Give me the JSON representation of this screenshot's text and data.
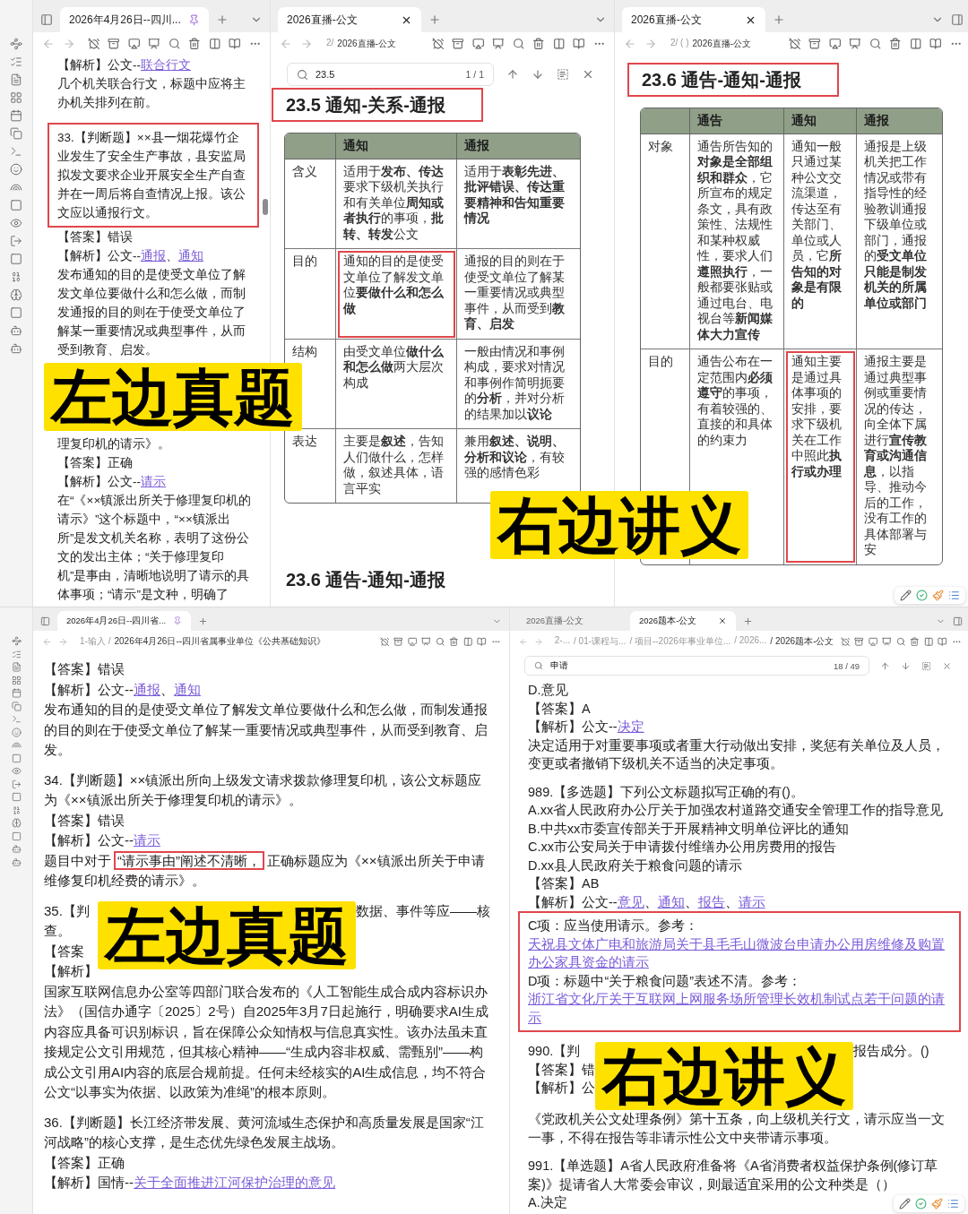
{
  "rows": [
    {
      "panes": [
        {
          "tabs": [
            {
              "label": "2026年4月26日--四川...",
              "selected": true,
              "pinned": true
            }
          ],
          "sections": [
            [
              {
                "kind": "text",
                "segments": [
                  {
                    "text": "【解析】公文--",
                    "link": false
                  },
                  {
                    "text": "联合行文",
                    "link": true
                  }
                ]
              },
              {
                "kind": "text",
                "text": "几个机关联合行文，标题中应将主办机关排列在前。"
              }
            ],
            [
              {
                "kind": "boxed",
                "paragraphs": [
                  {
                    "text": "33.【判断题】××县一烟花爆竹企业发生了安全生产事故，县安监局拟发文要求企业开展安全生产自查并在一周后将自查情况上报。该公文应以通报行文。"
                  }
                ]
              },
              {
                "kind": "text",
                "text": "【答案】错误"
              },
              {
                "kind": "text",
                "segments": [
                  {
                    "text": "【解析】公文--",
                    "link": false
                  },
                  {
                    "text": "通报",
                    "link": true
                  },
                  {
                    "text": "、",
                    "link": false
                  },
                  {
                    "text": "通知",
                    "link": true
                  }
                ]
              },
              {
                "kind": "text",
                "text": "发布通知的目的是使受文单位了解发文单位要做什么和怎么做，而制发通报的目的则在于使受文单位了解某一重要情况或典型事件，从而受到教育、启发。"
              },
              {
                "kind": "banner",
                "text": "左边真题"
              },
              {
                "kind": "text",
                "text": "理复印机的请示》。"
              },
              {
                "kind": "text",
                "text": "【答案】正确"
              },
              {
                "kind": "text",
                "segments": [
                  {
                    "text": "【解析】公文--",
                    "link": false
                  },
                  {
                    "text": "请示",
                    "link": true
                  }
                ]
              },
              {
                "kind": "text",
                "text": "在“《××镇派出所关于修理复印机的请示》”这个标题中，“××镇派出所”是发文机关名称，表明了这份公文的发出主体；“关于修理复印机”是事由，清晰地说明了请示的具体事项；“请示”是文种，明确了"
              }
            ]
          ]
        },
        {
          "tabs": [
            {
              "label": "2026直播-公文",
              "selected": true,
              "pinned": false
            }
          ],
          "breadcrumb": [
            "2/",
            "2026直播-公文"
          ],
          "search": {
            "query": "23.5",
            "count": "1 / 1"
          },
          "sections": [
            [
              {
                "kind": "heading",
                "text": "23.5 通知-关系-通报",
                "highlighted": true
              }
            ],
            [
              {
                "kind": "table",
                "columns": [
                  "通知",
                  "通报"
                ],
                "rows": [
                  {
                    "label": "含义",
                    "cells": [
                      {
                        "text": "适用于**发布、传达**要求下级机关执行和有关单位**周知或者执行**的事项，**批转、转发**公文",
                        "highlighted": false
                      },
                      {
                        "text": "适用于**表彰先进、批评错误、传达重要精神和告知重要情况**",
                        "highlighted": false
                      }
                    ]
                  },
                  {
                    "label": "目的",
                    "cells": [
                      {
                        "text": "通知的目的是使受文单位了解发文单位**要做什么和怎么做**",
                        "highlighted": true
                      },
                      {
                        "text": "通报的目的则在于使受文单位了解某一重要情况或典型事件，从而受到**教育、启发**",
                        "highlighted": false
                      }
                    ]
                  },
                  {
                    "label": "结构",
                    "cells": [
                      {
                        "text": "由受文单位**做什么和怎么做**两大层次构成",
                        "highlighted": false
                      },
                      {
                        "text": "一般由情况和事例构成，要求对情况和事例作简明扼要的**分析**，并对分析的结果加以**议论**",
                        "highlighted": false
                      }
                    ]
                  },
                  {
                    "label": "表达",
                    "cells": [
                      {
                        "text": "主要是**叙述**，告知人们做什么，怎样做，叙述具体，语言平实",
                        "highlighted": false
                      },
                      {
                        "text": "兼用**叙述、说明、分析和议论**，有较强的感情色彩",
                        "highlighted": false
                      }
                    ]
                  }
                ]
              },
              {
                "kind": "banner",
                "text": "右边讲义"
              },
              {
                "kind": "heading",
                "text": "23.6 通告-通知-通报",
                "highlighted": false
              }
            ]
          ]
        },
        {
          "tabs": [
            {
              "label": "2026直播-公文",
              "selected": true,
              "pinned": false
            }
          ],
          "breadcrumb": [
            "2/ ( )",
            "2026直播-公文"
          ],
          "sections": [
            [
              {
                "kind": "heading",
                "text": "23.6 通告-通知-通报",
                "highlighted": true
              }
            ],
            [
              {
                "kind": "table",
                "columns": [
                  "通告",
                  "通知",
                  "通报"
                ],
                "rows": [
                  {
                    "label": "对象",
                    "cells": [
                      {
                        "text": "通告所告知的**对象是全部组织和群众**，它所宣布的规定条文，具有政策性、法规性和某种权威性，要求人们**遵照执行**，一般都要张贴或通过电台、电视台等**新闻媒体大力宣传**",
                        "highlighted": false
                      },
                      {
                        "text": "通知一般只通过某种公文交流渠道，传达至有关部门、单位或人员，它**所告知的对象是有限的**",
                        "highlighted": false
                      },
                      {
                        "text": "通报是上级机关把工作情况或带有指导性的经验教训通报下级单位或部门，通报的**受文单位只能是制发机关的所属单位或部门**",
                        "highlighted": false
                      }
                    ]
                  },
                  {
                    "label": "目的",
                    "cells": [
                      {
                        "text": "通告公布在一定范围内**必须遵守**的事项，有着较强的、直接的和具体的约束力",
                        "highlighted": false
                      },
                      {
                        "text": "通知主要是通过具体事项的安排，要求下级机关在工作中照此**执行或办理**",
                        "highlighted": true
                      },
                      {
                        "text": "通报主要是通过典型事例或重要情况的传达，向全体下属进行**宣传教育或沟通信息**，以指导、推动今后的工作，没有工作的具体部署与安",
                        "highlighted": false
                      }
                    ]
                  }
                ]
              }
            ]
          ]
        }
      ]
    },
    {
      "panes": [
        {
          "tabs": [
            {
              "label": "2026年4月26日--四川省...",
              "selected": true,
              "pinned": true
            }
          ],
          "breadcrumb": [
            "1-输入 /",
            "2026年4月26日--四川省属事业单位《公共基础知识》"
          ],
          "sections": [
            [
              {
                "kind": "text",
                "text": "【答案】错误"
              },
              {
                "kind": "text",
                "segments": [
                  {
                    "text": "【解析】公文--",
                    "link": false
                  },
                  {
                    "text": "通报",
                    "link": true
                  },
                  {
                    "text": "、",
                    "link": false
                  },
                  {
                    "text": "通知",
                    "link": true
                  }
                ]
              },
              {
                "kind": "text",
                "text": "发布通知的目的是使受文单位了解发文单位要做什么和怎么做，而制发通报的目的则在于使受文单位了解某一重要情况或典型事件，从而受到教育、启发。"
              }
            ],
            [
              {
                "kind": "text",
                "text": "34.【判断题】××镇派出所向上级发文请求拨款修理复印机，该公文标题应为《××镇派出所关于修理复印机的请示》。"
              },
              {
                "kind": "text",
                "text": "【答案】错误"
              },
              {
                "kind": "text",
                "segments": [
                  {
                    "text": "【解析】公文--",
                    "link": false
                  },
                  {
                    "text": "请示",
                    "link": true
                  }
                ]
              },
              {
                "kind": "text",
                "segments": [
                  {
                    "text": "题目中对于",
                    "highlighted": false
                  },
                  {
                    "text": "“请示事由”阐述不清晰，",
                    "highlighted": true
                  },
                  {
                    "text": "正确标题应为《××镇派出所关于申请维修复印机经费的请示》。",
                    "highlighted": false
                  }
                ]
              }
            ],
            [
              {
                "kind": "banner_row",
                "left": [
                  "35.【判",
                  "查。",
                  "【答案",
                  "【解析】"
                ],
                "banner": "左边真题",
                "right": [
                  "数据、事件等应——核"
                ]
              },
              {
                "kind": "text",
                "text": "国家互联网信息办公室等四部门联合发布的《人工智能生成合成内容标识办法》（国信办通字〔2025〕2号）自2025年3月7日起施行，明确要求AI生成内容应具备可识别标识，旨在保障公众知情权与信息真实性。该办法虽未直接规定公文引用规范，但其核心精神——“生成内容非权威、需甄别”——构成公文引用AI内容的底层合规前提。任何未经核实的AI生成信息，均不符合公文“以事实为依据、以政策为准绳”的根本原则。"
              }
            ],
            [
              {
                "kind": "text",
                "text": "36.【判断题】长江经济带发展、黄河流域生态保护和高质量发展是国家“江河战略”的核心支撑，是生态优先绿色发展主战场。"
              },
              {
                "kind": "text",
                "text": "【答案】正确"
              },
              {
                "kind": "text",
                "segments": [
                  {
                    "text": "【解析】国情--",
                    "link": false
                  },
                  {
                    "text": "关于全面推进江河保护治理的意见",
                    "link": true
                  }
                ]
              }
            ]
          ]
        },
        {
          "tabs": [
            {
              "label": "2026直播-公文",
              "selected": false,
              "pinned": false
            },
            {
              "label": "2026题本-公文",
              "selected": true,
              "pinned": false
            }
          ],
          "breadcrumb": [
            "2-...",
            "/ 01-课程与...",
            "/ 项目--2026年事业单位...",
            "/ 2026...",
            "/ 2026题本-公文"
          ],
          "search": {
            "query": "申请",
            "count": "18 / 49"
          },
          "sections": [
            [
              {
                "kind": "text",
                "text": "D.意见"
              },
              {
                "kind": "text",
                "text": "【答案】A"
              },
              {
                "kind": "text",
                "segments": [
                  {
                    "text": "【解析】公文--",
                    "link": false
                  },
                  {
                    "text": "决定",
                    "link": true
                  }
                ]
              },
              {
                "kind": "text",
                "text": "决定适用于对重要事项或者重大行动做出安排，奖惩有关单位及人员，变更或者撤销下级机关不适当的决定事项。"
              }
            ],
            [
              {
                "kind": "text",
                "text": "989.【多选题】下列公文标题拟写正确的有()。"
              },
              {
                "kind": "text",
                "text": "A.xx省人民政府办公厅关于加强农村道路交通安全管理工作的指导意见"
              },
              {
                "kind": "text",
                "text": "B.中共xx市委宣传部关于开展精神文明单位评比的通知"
              },
              {
                "kind": "text",
                "text": "C.xx市公安局关于申请拨付维缮办公用房费用的报告"
              },
              {
                "kind": "text",
                "text": "D.xx县人民政府关于粮食问题的请示"
              },
              {
                "kind": "text",
                "text": "【答案】AB"
              },
              {
                "kind": "text",
                "segments": [
                  {
                    "text": "【解析】公文--",
                    "link": false
                  },
                  {
                    "text": "意见",
                    "link": true
                  },
                  {
                    "text": "、",
                    "link": false
                  },
                  {
                    "text": "通知",
                    "link": true
                  },
                  {
                    "text": "、",
                    "link": false
                  },
                  {
                    "text": "报告",
                    "link": true
                  },
                  {
                    "text": "、",
                    "link": false
                  },
                  {
                    "text": "请示",
                    "link": true
                  }
                ]
              },
              {
                "kind": "boxed",
                "paragraphs": [
                  {
                    "segments": [
                      {
                        "text": "C项：应当使用请示。参考：",
                        "link": false
                      },
                      {
                        "text": "天祝县文体广电和旅游局关于县毛毛山微波台申请办公用房维修及购置办公家具资金的请示",
                        "link": true
                      }
                    ]
                  },
                  {
                    "segments": [
                      {
                        "text": "D项：标题中“关于粮食问题”表述不清。参考：",
                        "link": false
                      },
                      {
                        "text": "浙江省文化厅关于互联网上网服务场所管理长效机制试点若干问题的请示",
                        "link": true
                      }
                    ]
                  }
                ]
              }
            ],
            [
              {
                "kind": "banner_row",
                "left": [
                  "990.【判",
                  "【答案】错",
                  "【解析】公"
                ],
                "banner": "右边讲义",
                "right": [
                  "报告成分。()"
                ]
              },
              {
                "kind": "text",
                "text": "《党政机关公文处理条例》第十五条，向上级机关行文，请示应当一文一事，不得在报告等非请示性公文中夹带请示事项。"
              }
            ],
            [
              {
                "kind": "text",
                "text": "991.【单选题】A省人民政府准备将《A省消费者权益保护条例(修订草案)》提请省人大常委会审议，则最适宜采用的公文种类是（）"
              },
              {
                "kind": "text",
                "text": "A.决定"
              }
            ]
          ]
        }
      ]
    }
  ]
}
